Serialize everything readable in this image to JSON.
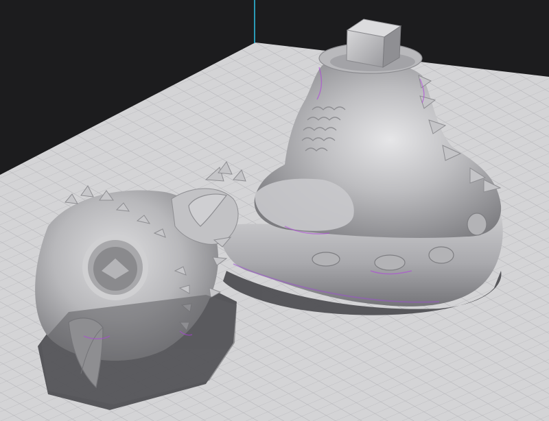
{
  "viewport": {
    "background_color": "#1c1c1e",
    "axis_line_color": "#2ec4e8",
    "build_plate": {
      "fill_color": "#d4d4d6",
      "grid_color": "#b2b2b6",
      "grid": true
    },
    "models": [
      {
        "name": "creature-body",
        "color": "#bdbdc0",
        "shadow_color": "#505054"
      },
      {
        "name": "creature-head",
        "color": "#bdbdc0",
        "shadow_color": "#505054"
      }
    ],
    "overhang_highlight_color": "#b040e0"
  }
}
